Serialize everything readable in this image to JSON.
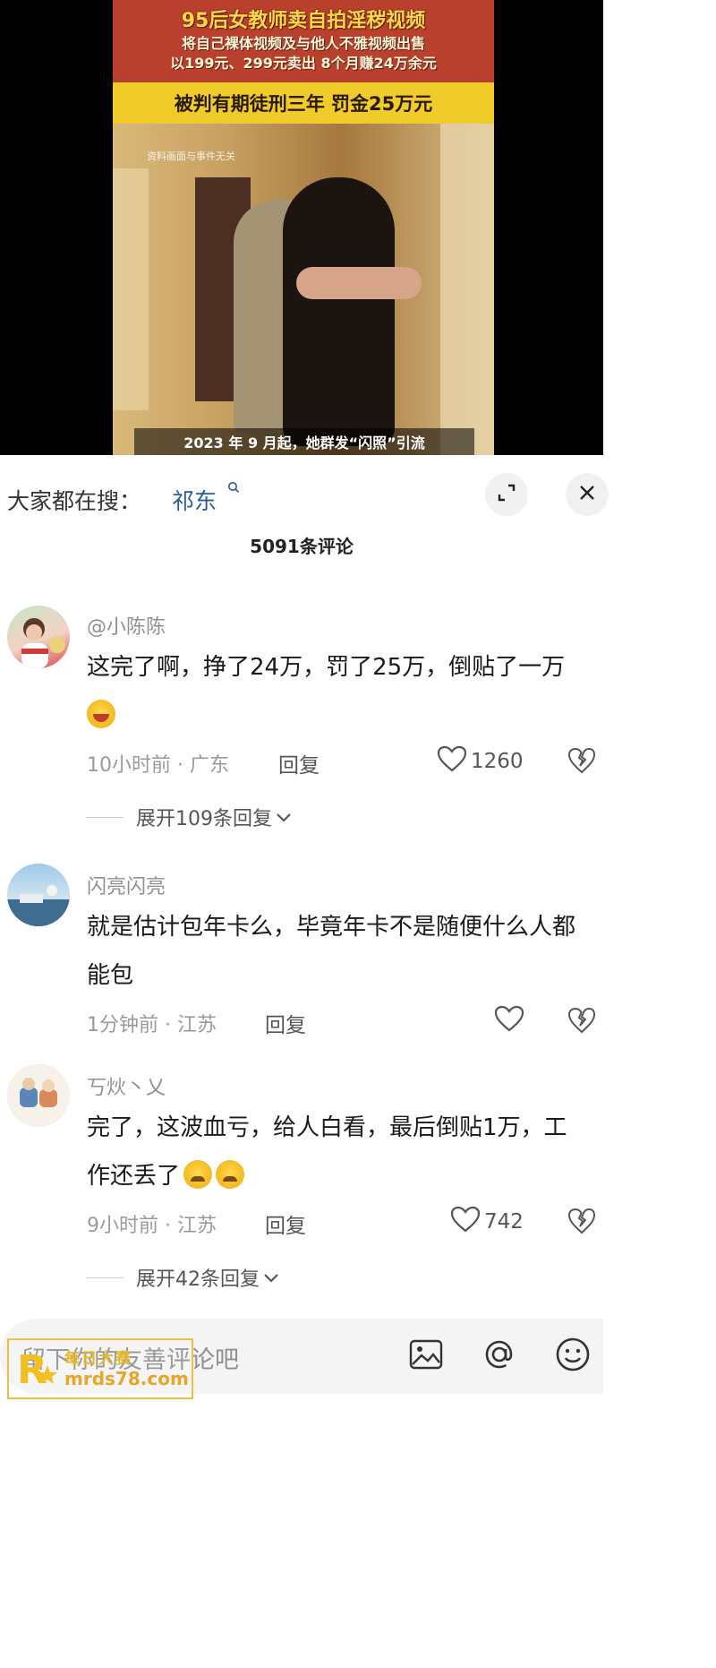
{
  "video": {
    "banner_line1": "95后女教师卖自拍淫秽视频",
    "banner_line2": "将自己裸体视频及与他人不雅视频出售",
    "banner_line3": "以199元、299元卖出 8个月赚24万余元",
    "verdict": "被判有期徒刑三年 罚金25万元",
    "disclaimer": "资料画面与事件无关",
    "caption": "2023 年 9 月起，她群发“闪照”引流"
  },
  "search": {
    "label": "大家都在搜：",
    "term": "祁东"
  },
  "comment_count": "5091条评论",
  "comments": [
    {
      "username": "@小陈陈",
      "text": "这完了啊，挣了24万，罚了25万，倒贴了一万",
      "time_location": "10小时前 · 广东",
      "reply_label": "回复",
      "likes": "1260",
      "expand_label": "展开109条回复"
    },
    {
      "username": "闪亮闪亮",
      "text": "就是估计包年卡么，毕竟年卡不是随便什么人都能包",
      "time_location": "1分钟前 · 江苏",
      "reply_label": "回复",
      "likes": ""
    },
    {
      "username": "丂炏丶乂",
      "text": "完了，这波血亏，给人白看，最后倒贴1万，工作还丢了",
      "time_location": "9小时前 · 江苏",
      "reply_label": "回复",
      "likes": "742",
      "expand_label": "展开42条回复"
    }
  ],
  "input": {
    "placeholder": "留下你的友善评论吧"
  },
  "watermark": {
    "line1": "每日大赛",
    "line2": "mrds78.com"
  },
  "colors": {
    "accent_link": "#2a5d94",
    "banner_red": "#b8402c",
    "verdict_yellow": "#f0cc2a"
  }
}
